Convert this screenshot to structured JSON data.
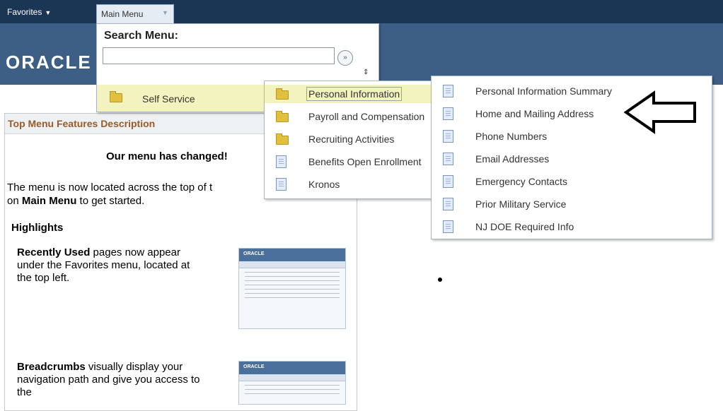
{
  "topbar": {
    "favorites": "Favorites",
    "main_menu": "Main Menu"
  },
  "header": {
    "logo": "ORACLE"
  },
  "main_menu_dropdown": {
    "search_label": "Search Menu:",
    "search_value": "",
    "go_glyph": "»",
    "items": [
      {
        "label": "Self Service",
        "icon": "folder-icon"
      }
    ]
  },
  "submenu_self_service": {
    "items": [
      {
        "label": "Personal Information",
        "icon": "folder-icon",
        "selected": true
      },
      {
        "label": "Payroll and Compensation",
        "icon": "folder-icon"
      },
      {
        "label": "Recruiting Activities",
        "icon": "folder-icon"
      },
      {
        "label": "Benefits Open Enrollment",
        "icon": "document-icon"
      },
      {
        "label": "Kronos",
        "icon": "document-icon"
      }
    ]
  },
  "submenu_personal_information": {
    "items": [
      {
        "label": "Personal Information Summary",
        "icon": "document-icon"
      },
      {
        "label": "Home and Mailing Address",
        "icon": "document-icon"
      },
      {
        "label": "Phone Numbers",
        "icon": "document-icon"
      },
      {
        "label": "Email Addresses",
        "icon": "document-icon"
      },
      {
        "label": "Emergency Contacts",
        "icon": "document-icon"
      },
      {
        "label": "Prior Military Service",
        "icon": "document-icon"
      },
      {
        "label": "NJ DOE Required Info",
        "icon": "document-icon"
      }
    ]
  },
  "panel": {
    "title": "Top Menu Features Description",
    "changed": "Our menu has changed!",
    "intro_part1": "The menu is now located across the top of t",
    "intro_part2": "on ",
    "intro_bold": "Main Menu",
    "intro_part3": " to get started.",
    "highlights": "Highlights",
    "recent_bold": "Recently Used",
    "recent_text": " pages now appear under the Favorites menu, located at the top left.",
    "bread_bold": "Breadcrumbs",
    "bread_text": " visually display your navigation path and give you access to the"
  },
  "colors": {
    "topbar": "#1b3554",
    "header": "#3d5f86",
    "highlight": "#f3f3c0",
    "panel_title": "#9a5a27"
  }
}
